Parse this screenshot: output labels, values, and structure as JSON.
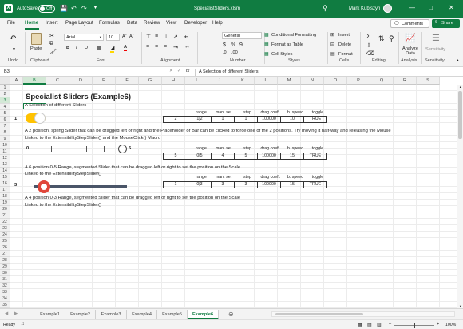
{
  "title_bar": {
    "autosave_label": "AutoSave",
    "autosave_state": "Off",
    "filename": "SpecialistSliders.xlsm",
    "user_name": "Mark Kubiszyn"
  },
  "menu": [
    "File",
    "Home",
    "Insert",
    "Page Layout",
    "Formulas",
    "Data",
    "Review",
    "View",
    "Developer",
    "Help"
  ],
  "menu_active": "Home",
  "comments_label": "Comments",
  "share_label": "Share",
  "ribbon": {
    "paste": "Paste",
    "font_name": "Arial",
    "font_size": "10",
    "number_format": "General",
    "conditional": "Conditional Formatting",
    "format_table": "Format as Table",
    "cell_styles": "Cell Styles",
    "insert": "Insert",
    "delete": "Delete",
    "format": "Format",
    "analyze": "Analyze Data",
    "sensitivity": "Sensitivity",
    "groups": [
      "Undo",
      "Clipboard",
      "Font",
      "Alignment",
      "Number",
      "Styles",
      "Cells",
      "Editing",
      "Analysis",
      "Sensitivity"
    ]
  },
  "formula_bar": {
    "name_box": "B3",
    "fx": "fx",
    "content": "A Selection of different Sliders"
  },
  "columns": [
    "A",
    "B",
    "C",
    "D",
    "E",
    "F",
    "G",
    "H",
    "I",
    "J",
    "K",
    "L",
    "M",
    "N",
    "O",
    "P",
    "Q",
    "R",
    "S"
  ],
  "rows": [
    "1",
    "2",
    "3",
    "4",
    "5",
    "6",
    "7",
    "8",
    "9",
    "10",
    "11",
    "12",
    "13",
    "14",
    "15",
    "16",
    "17",
    "18",
    "19",
    "20",
    "21",
    "22",
    "23",
    "24",
    "25",
    "26",
    "27",
    "28",
    "29",
    "30",
    "31",
    "32",
    "33",
    "34",
    "35"
  ],
  "sheet": {
    "title": "Specialist Sliders (Example6)",
    "subtitle": "A Selection of different Sliders",
    "headers": [
      "range",
      "man. set",
      "step",
      "drag coeff.",
      "b. speed",
      "toggle"
    ],
    "slider1": {
      "label": "1",
      "values": [
        "2",
        "1|2",
        "1",
        "1",
        "100000",
        "10",
        "TRUE"
      ],
      "desc1": "A 2 position, spring Slider that can be dragged left or right and the Placeholder or Bar can be clicked to force one of the 2 positions.  Try moving it half-way and releasing the Mouse",
      "desc2": "Linked to the ExtensibilityStepSlider() and the MouseClick() Macro"
    },
    "slider2": {
      "min": "0",
      "max": "5",
      "values": [
        "5",
        "0|5",
        "4",
        "5",
        "100000",
        "15",
        "TRUE"
      ],
      "desc1": "A 6 position 0-5 Range, segmented Slider that can be dragged left or right to set the position on the Scale",
      "desc2": "Linked to the ExtensibilityStepSlider()"
    },
    "slider3": {
      "label": "3",
      "values": [
        "1",
        "0|3",
        "3",
        "3",
        "100000",
        "15",
        "TRUE"
      ],
      "desc1": "A 4 position 0-3 Range, segmented Slider that can be dragged left or right to set the position on the Scale",
      "desc2": "Linked to the ExtensibilityStepSlider()"
    }
  },
  "sheet_tabs": [
    "Example1",
    "Example2",
    "Example3",
    "Example4",
    "Example5",
    "Example6"
  ],
  "active_tab": "Example6",
  "status": "Ready",
  "zoom": "100%"
}
